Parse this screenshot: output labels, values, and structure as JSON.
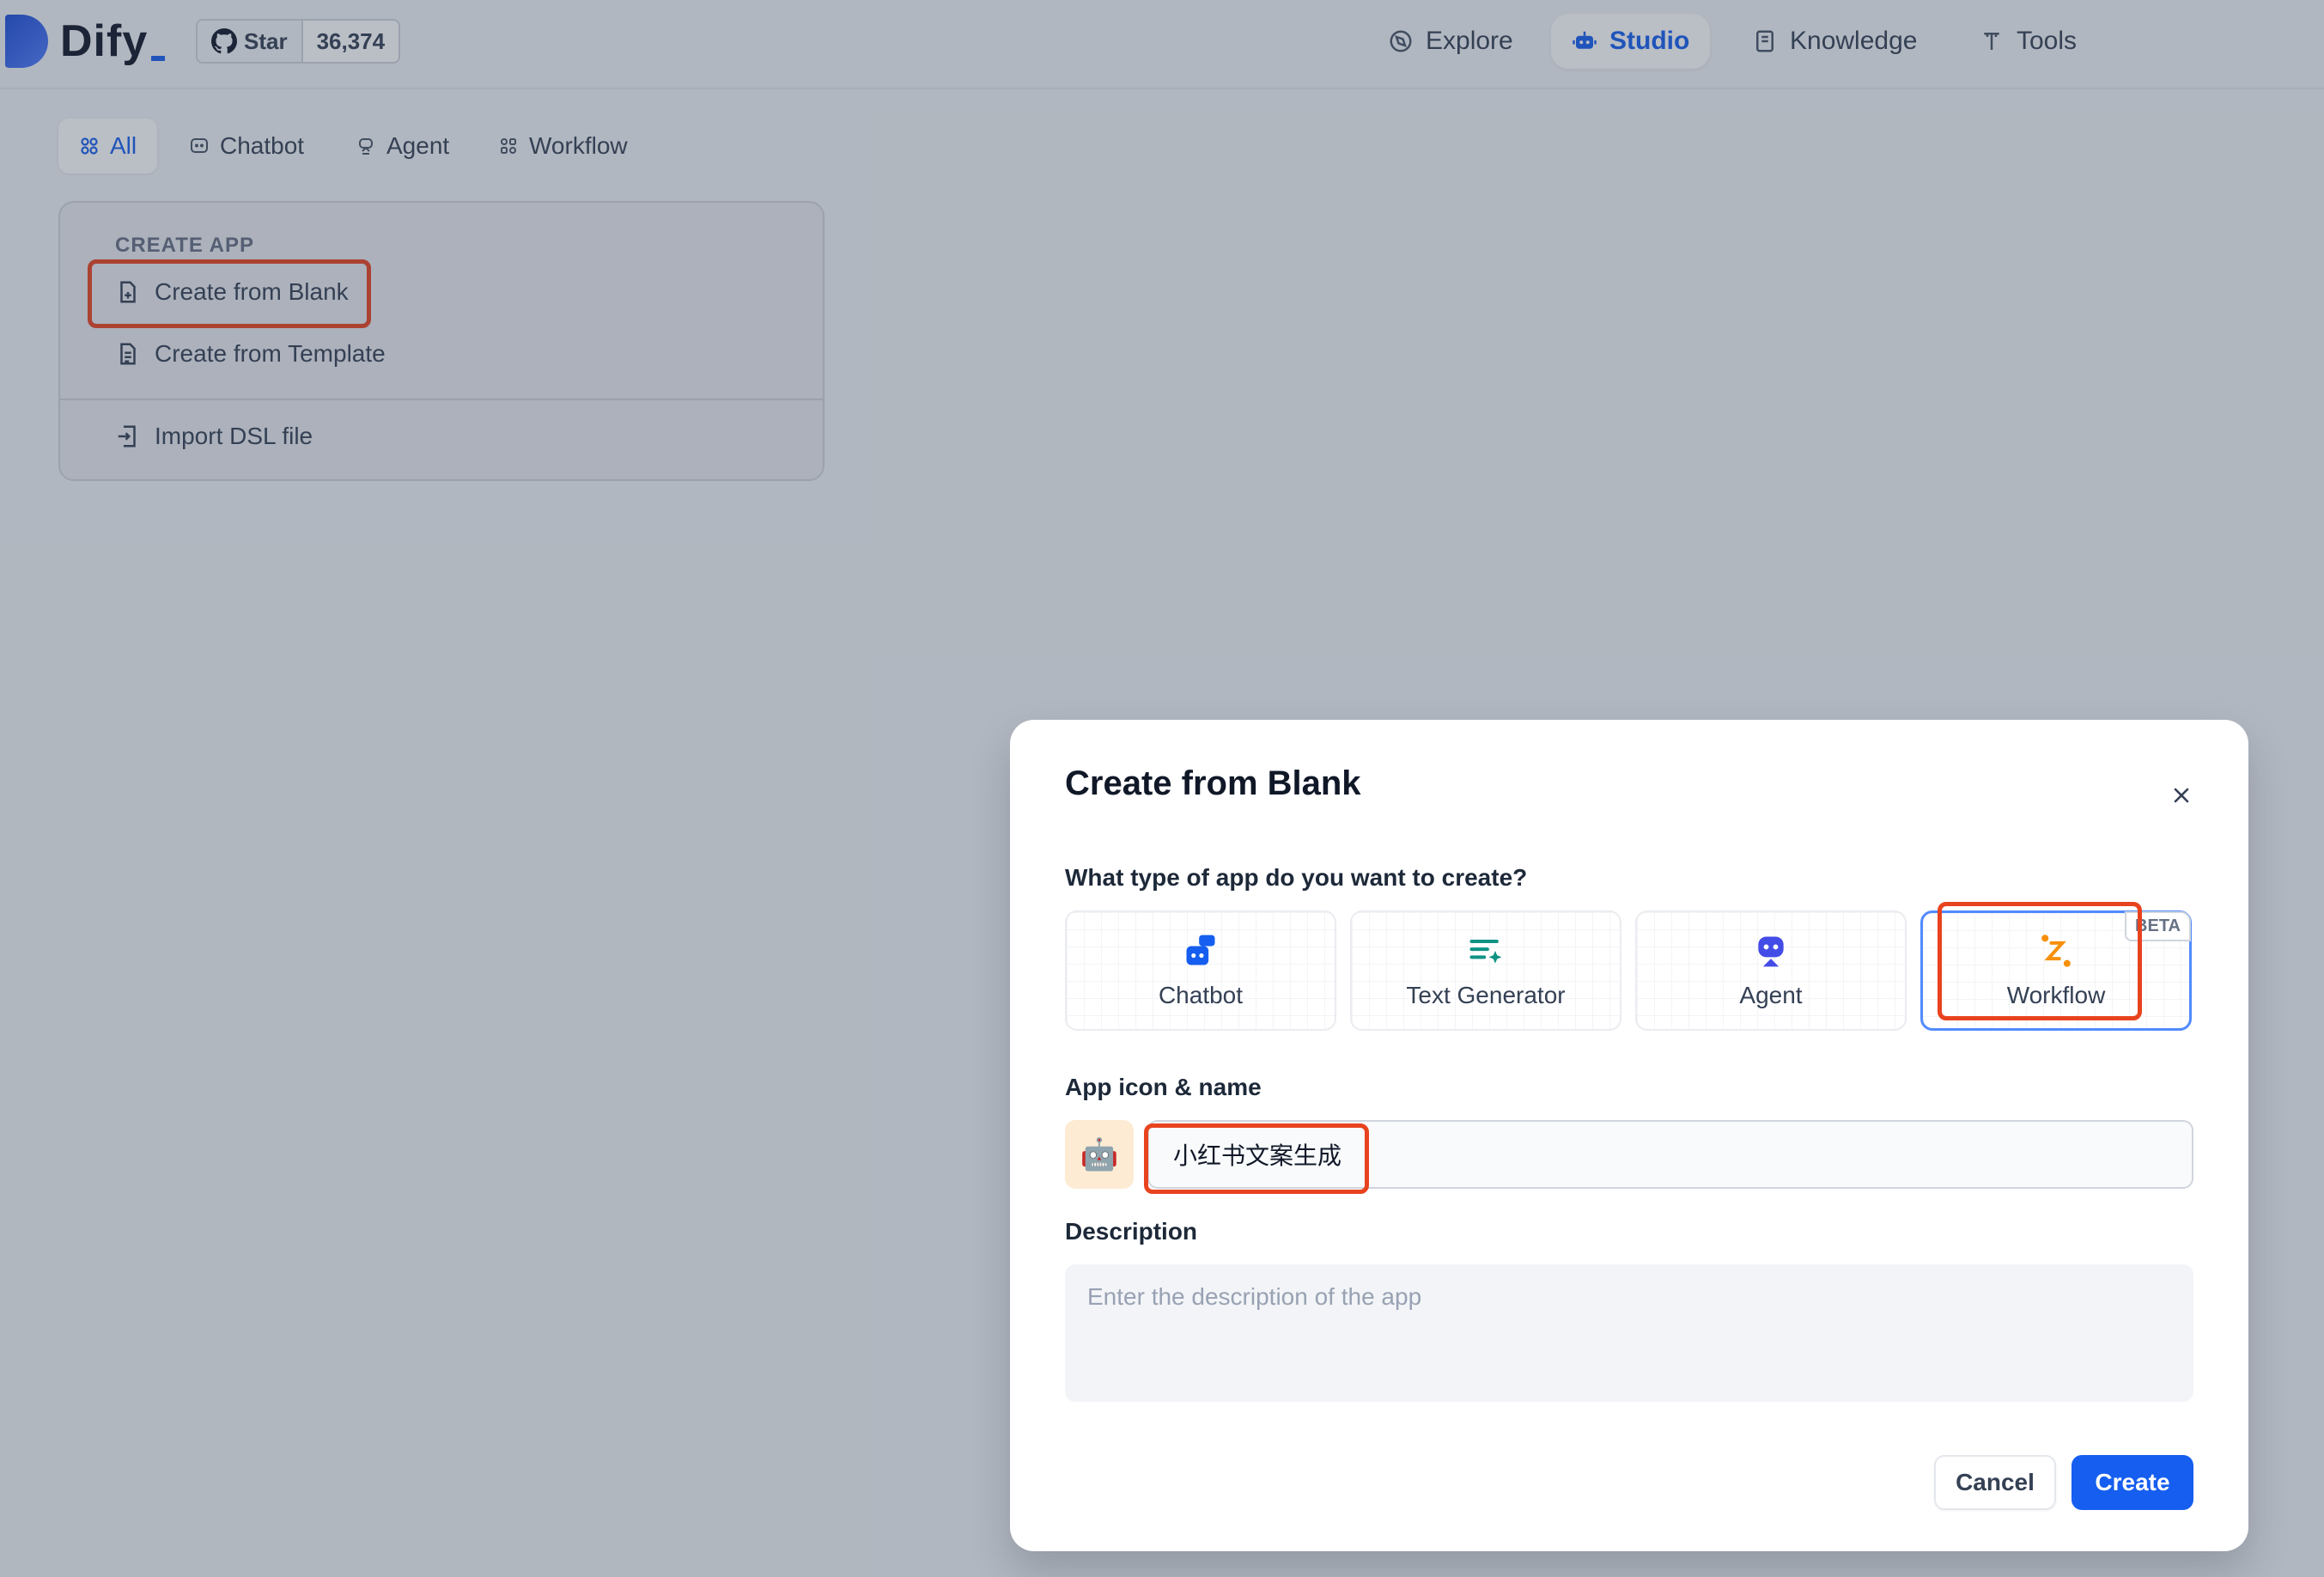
{
  "app": {
    "brand": "Dify"
  },
  "github": {
    "star_label": "Star",
    "star_count": "36,374"
  },
  "nav": [
    {
      "label": "Explore",
      "icon": "compass-icon",
      "active": false
    },
    {
      "label": "Studio",
      "icon": "robot-icon",
      "active": true
    },
    {
      "label": "Knowledge",
      "icon": "book-icon",
      "active": false
    },
    {
      "label": "Tools",
      "icon": "tool-icon",
      "active": false
    }
  ],
  "filters": [
    {
      "label": "All",
      "icon": "grid-icon",
      "active": true
    },
    {
      "label": "Chatbot",
      "icon": "chat-icon",
      "active": false
    },
    {
      "label": "Agent",
      "icon": "agent-icon",
      "active": false
    },
    {
      "label": "Workflow",
      "icon": "workflow-icon",
      "active": false
    }
  ],
  "create_app": {
    "label": "CREATE APP",
    "items": [
      {
        "label": "Create from Blank",
        "icon": "file-plus-icon"
      },
      {
        "label": "Create from Template",
        "icon": "file-text-icon"
      },
      {
        "label": "Import DSL file",
        "icon": "file-import-icon"
      }
    ]
  },
  "modal": {
    "title": "Create from Blank",
    "question": "What type of app do you want to create?",
    "types": [
      {
        "label": "Chatbot",
        "icon": "chatbot-icon",
        "color": "#155eef",
        "selected": false
      },
      {
        "label": "Text Generator",
        "icon": "text-generator-icon",
        "color": "#0e9384",
        "selected": false
      },
      {
        "label": "Agent",
        "icon": "agent-icon",
        "color": "#444ce7",
        "selected": false
      },
      {
        "label": "Workflow",
        "icon": "workflow-icon",
        "color": "#f79009",
        "selected": true,
        "badge": "BETA"
      }
    ],
    "icon_name_label": "App icon & name",
    "app_icon": "🤖",
    "app_name": "小红书文案生成",
    "description_label": "Description",
    "description_placeholder": "Enter the description of the app",
    "cancel_label": "Cancel",
    "create_label": "Create"
  },
  "colors": {
    "accent": "#155eef",
    "highlight": "#e8431f",
    "selected_border": "#528bff"
  }
}
